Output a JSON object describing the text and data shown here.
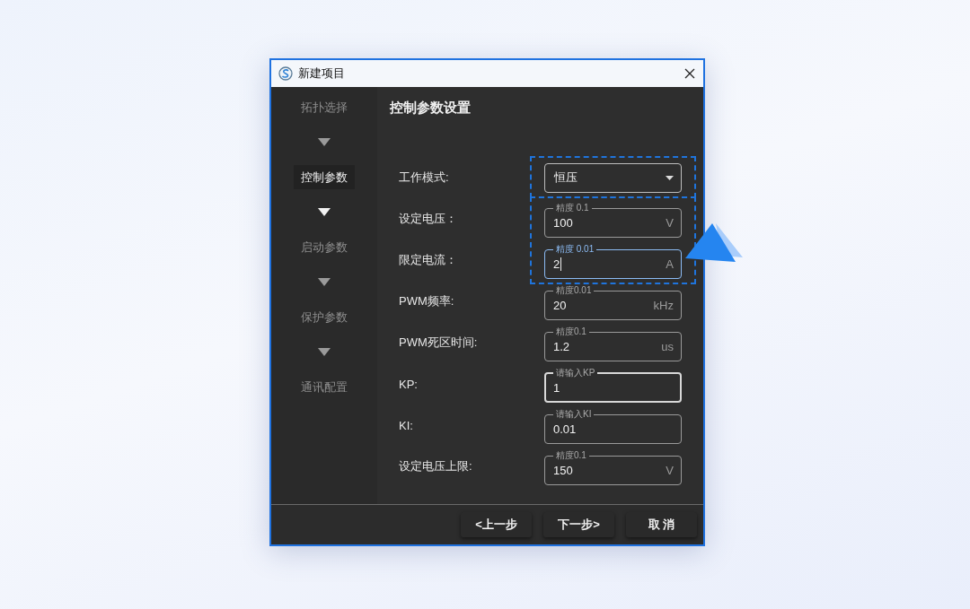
{
  "window": {
    "title": "新建项目"
  },
  "sidebar": {
    "items": [
      {
        "label": "拓扑选择",
        "selected": false
      },
      {
        "label": "控制参数",
        "selected": true
      },
      {
        "label": "启动参数",
        "selected": false
      },
      {
        "label": "保护参数",
        "selected": false
      },
      {
        "label": "通讯配置",
        "selected": false
      }
    ]
  },
  "section_title": "控制参数设置",
  "fields": [
    {
      "label": "工作模式:",
      "kind": "select",
      "value": "恒压",
      "outlined": true
    },
    {
      "label": "设定电压：",
      "kind": "input",
      "hint": "精度 0.1",
      "value": "100",
      "unit": "V",
      "outlined": true,
      "focused": false,
      "hovered": false
    },
    {
      "label": "限定电流：",
      "kind": "input",
      "hint": "精度 0.01",
      "value": "2",
      "unit": "A",
      "outlined": true,
      "focused": true,
      "hovered": false
    },
    {
      "label": "PWM频率:",
      "kind": "input",
      "hint": "精度0.01",
      "value": "20",
      "unit": "kHz",
      "focused": false,
      "hovered": false
    },
    {
      "label": "PWM死区时间:",
      "kind": "input",
      "hint": "精度0.1",
      "value": "1.2",
      "unit": "us",
      "focused": false,
      "hovered": false
    },
    {
      "label": "KP:",
      "kind": "input",
      "hint": "请输入KP",
      "value": "1",
      "focused": false,
      "hovered": true
    },
    {
      "label": "KI:",
      "kind": "input",
      "hint": "请输入KI",
      "value": "0.01",
      "focused": false,
      "hovered": false
    },
    {
      "label": "设定电压上限:",
      "kind": "input",
      "hint": "精度0.1",
      "value": "150",
      "unit": "V",
      "focused": false,
      "hovered": false
    }
  ],
  "pointer": {
    "kind": "arrow"
  },
  "buttons": [
    "<上一步",
    "下一步>",
    "取 消"
  ]
}
